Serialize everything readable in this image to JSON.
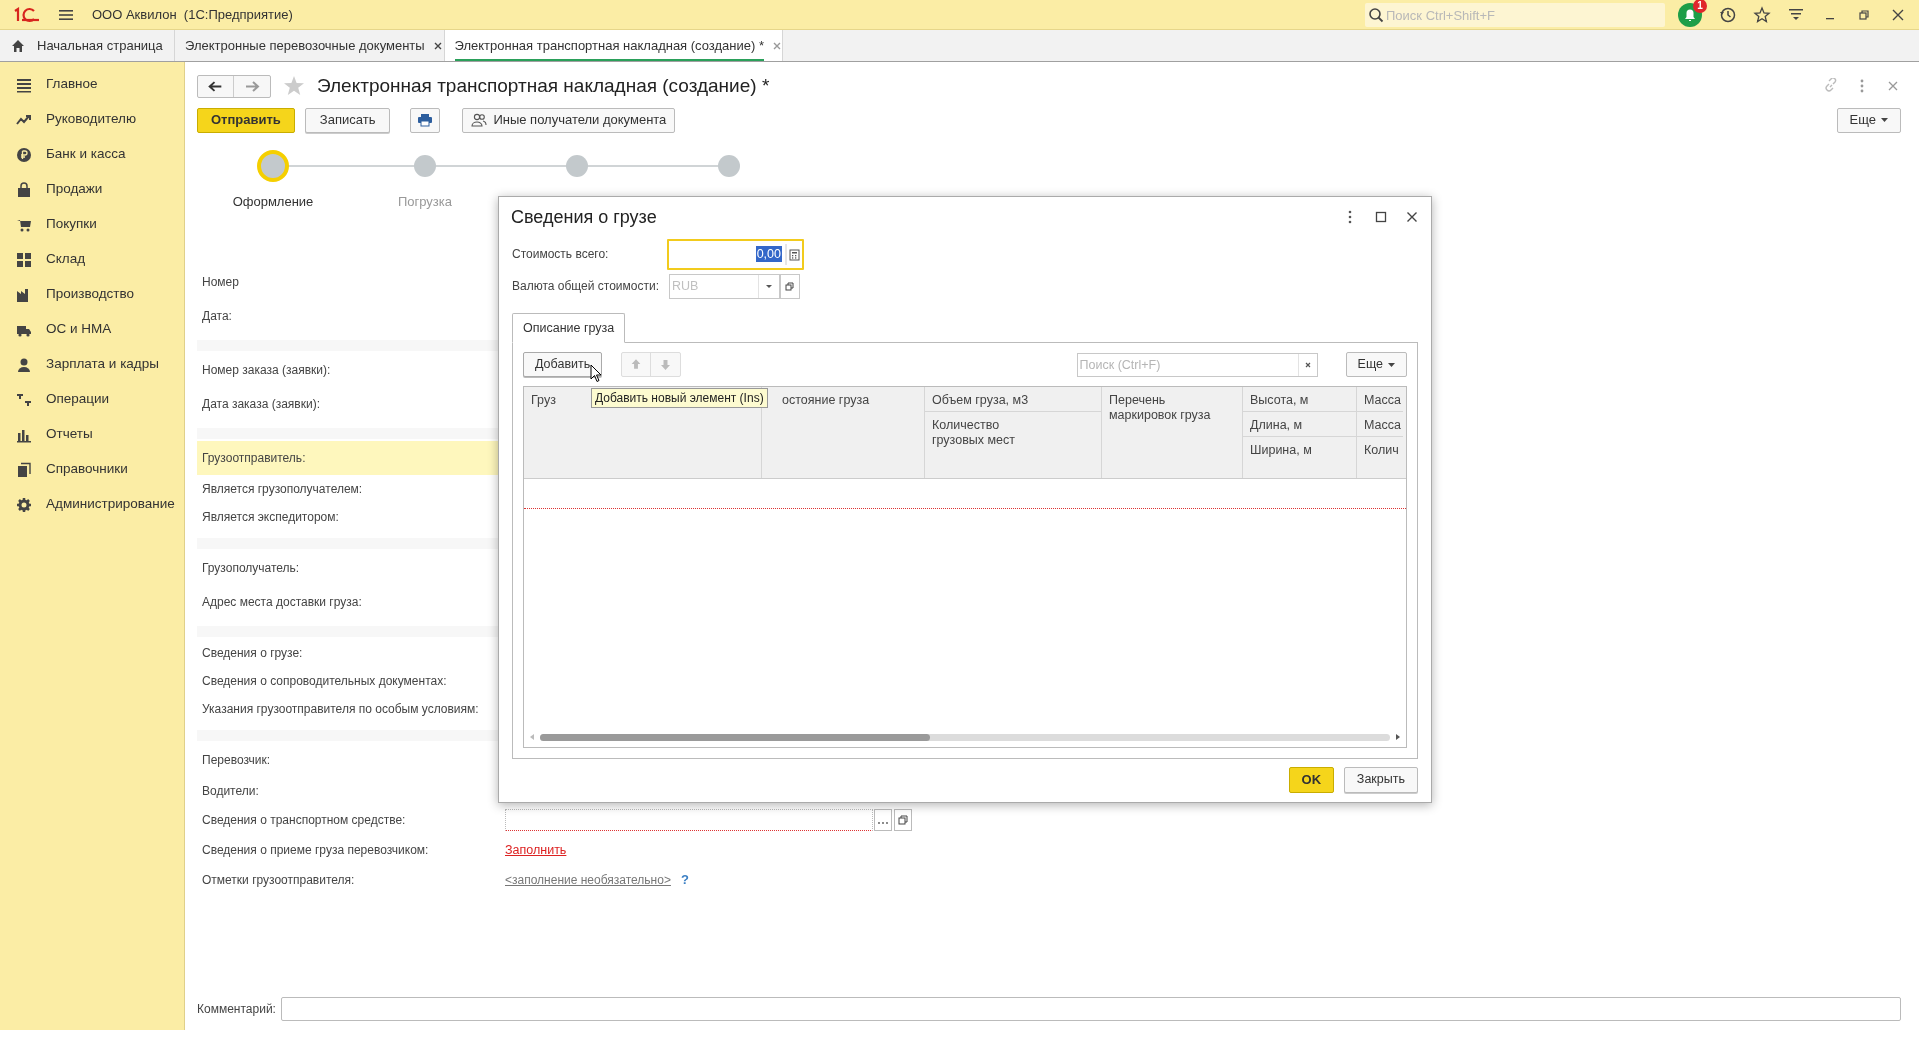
{
  "title_bar": {
    "app_title": "ООО Аквилон  (1С:Предприятие)",
    "search": {
      "placeholder": "Поиск Ctrl+Shift+F"
    },
    "notification_count": "1"
  },
  "tabs": [
    {
      "label": "Начальная страница",
      "kind": "home",
      "selected": false
    },
    {
      "label": "Электронные перевозочные документы",
      "kind": "doc",
      "selected": false
    },
    {
      "label": "Электронная транспортная накладная (создание) *",
      "kind": "doc",
      "selected": true
    }
  ],
  "sidebar": {
    "items": [
      "Главное",
      "Руководителю",
      "Банк и касса",
      "Продажи",
      "Покупки",
      "Склад",
      "Производство",
      "ОС и НМА",
      "Зарплата и кадры",
      "Операции",
      "Отчеты",
      "Справочники",
      "Администрирование"
    ]
  },
  "document": {
    "title": "Электронная транспортная накладная (создание) *",
    "buttons": [
      {
        "kind": "primary",
        "label": "Отправить"
      },
      {
        "kind": "normal",
        "label": "Записать"
      },
      {
        "kind": "print"
      },
      {
        "kind": "recipients",
        "label": "Иные получатели документа"
      }
    ],
    "more_button": "Еще",
    "steps": [
      {
        "label": "Оформление",
        "selected": true
      },
      {
        "label": "Погрузка",
        "selected": false
      },
      {
        "selected": false
      },
      {
        "selected": false
      }
    ],
    "rows": [
      {
        "kind": "plain",
        "label": "Номер"
      },
      {
        "kind": "plain",
        "label": "Дата:"
      },
      {
        "kind": "gap"
      },
      {
        "kind": "plain",
        "label": "Номер заказа (заявки):"
      },
      {
        "kind": "plain",
        "label": "Дата заказа (заявки):"
      },
      {
        "kind": "gap"
      },
      {
        "kind": "highlight",
        "label": "Грузоотправитель:"
      },
      {
        "kind": "short",
        "label": "Является грузополучателем:"
      },
      {
        "kind": "short",
        "label": "Является экспедитором:"
      },
      {
        "kind": "gap"
      },
      {
        "kind": "plain",
        "label": "Грузополучатель:"
      },
      {
        "kind": "plain",
        "label": "Адрес места доставки груза:"
      },
      {
        "kind": "gap"
      },
      {
        "kind": "short",
        "label": "Сведения о грузе:"
      },
      {
        "kind": "short",
        "label": "Сведения о сопроводительных документах:"
      },
      {
        "kind": "short",
        "label": "Указания грузоотправителя по особым условиям:"
      },
      {
        "kind": "gap"
      },
      {
        "kind": "plain",
        "label": "Перевозчик:"
      },
      {
        "kind": "short",
        "label": "Водители:"
      },
      {
        "kind": "input",
        "label": "Сведения о транспортном средстве:"
      },
      {
        "kind": "link",
        "label": "Сведения о приеме груза перевозчиком:",
        "value": "Заполнить"
      },
      {
        "kind": "optional",
        "label": "Отметки грузоотправителя:",
        "value": "<заполнение необязательно>",
        "help": "?"
      }
    ],
    "comment": {
      "label": "Комментарий:"
    }
  },
  "dialog": {
    "title": "Сведения о грузе",
    "total": {
      "label": "Стоимость всего:",
      "value": "0,00"
    },
    "currency": {
      "label": "Валюта общей стоимости:",
      "placeholder": "RUB"
    },
    "tabs": [
      {
        "label": "Описание груза",
        "selected": true
      }
    ],
    "toolbar": {
      "add": "Добавить",
      "search_placeholder": "Поиск (Ctrl+F)",
      "more": "Еще"
    },
    "tooltip": "Добавить новый элемент (Ins)",
    "table": {
      "columns": [
        {
          "cells": [
            "Груз"
          ]
        },
        {
          "cells": [
            "остояние груза"
          ]
        },
        {
          "cells": [
            "Объем груза, м3",
            "Количество грузовых мест"
          ]
        },
        {
          "cells": [
            "Перечень маркировок груза"
          ]
        },
        {
          "cells": [
            "Высота, м",
            "Длина, м",
            "Ширина, м"
          ]
        },
        {
          "cells": [
            "Масса",
            "Масса",
            "Колич"
          ]
        }
      ]
    },
    "buttons": [
      {
        "kind": "primary",
        "label": "OK"
      },
      {
        "kind": "normal",
        "label": "Закрыть"
      }
    ]
  }
}
